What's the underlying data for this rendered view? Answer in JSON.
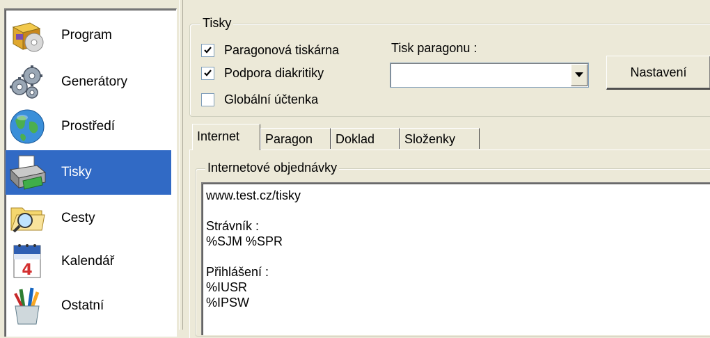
{
  "sidebar": {
    "items": [
      {
        "label": "Program",
        "icon": "program-box-disc-icon",
        "selected": false
      },
      {
        "label": "Generátory",
        "icon": "gears-icon",
        "selected": false
      },
      {
        "label": "Prostředí",
        "icon": "globe-icon",
        "selected": false
      },
      {
        "label": "Tisky",
        "icon": "printer-icon",
        "selected": true
      },
      {
        "label": "Cesty",
        "icon": "folder-search-icon",
        "selected": false
      },
      {
        "label": "Kalendář",
        "icon": "calendar-icon",
        "selected": false
      },
      {
        "label": "Ostatní",
        "icon": "pens-cup-icon",
        "selected": false
      }
    ]
  },
  "tisky_group": {
    "legend": "Tisky",
    "checkboxes": [
      {
        "label": "Paragonová tiskárna",
        "checked": true
      },
      {
        "label": "Podpora diakritiky",
        "checked": true
      },
      {
        "label": "Globální účtenka",
        "checked": false
      }
    ],
    "print_receipt_label": "Tisk paragonu :",
    "print_receipt_value": "",
    "settings_button": "Nastavení"
  },
  "tabs": [
    {
      "label": "Internet",
      "active": true
    },
    {
      "label": "Paragon",
      "active": false
    },
    {
      "label": "Doklad",
      "active": false
    },
    {
      "label": "Složenky",
      "active": false
    }
  ],
  "internet_group": {
    "legend": "Internetové objednávky",
    "text_lines": [
      "www.test.cz/tisky",
      "",
      "Strávník :",
      "%SJM %SPR",
      "",
      "Přihlášení :",
      "%IUSR",
      "%IPSW"
    ]
  },
  "colors": {
    "selection": "#316ac5",
    "face": "#ece9d8"
  }
}
